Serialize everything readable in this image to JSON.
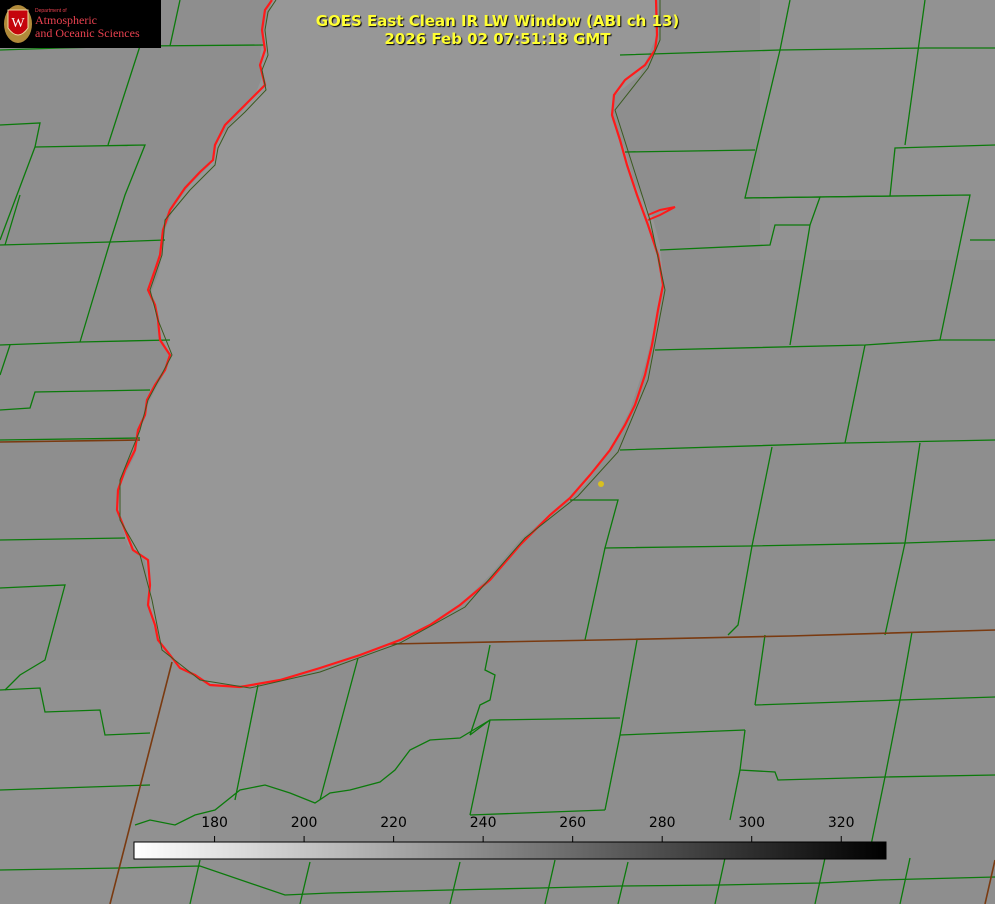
{
  "header": {
    "title": "GOES East Clean IR LW Window (ABI ch 13)",
    "timestamp": "2026 Feb 02 07:51:18 GMT"
  },
  "logo": {
    "department": "Department of",
    "line1": "Atmospheric",
    "line2": "and Oceanic Sciences",
    "seal_letter": "W"
  },
  "colorbar": {
    "tick_labels": [
      "180",
      "200",
      "220",
      "240",
      "260",
      "280",
      "300",
      "320"
    ],
    "tick_values": [
      180,
      200,
      220,
      240,
      260,
      280,
      300,
      320
    ],
    "range": [
      162,
      330
    ],
    "gradient": [
      "#ffffff",
      "#000000"
    ]
  },
  "colors": {
    "background": "#8f8f8f",
    "lake": "#969696",
    "county_lines": "#0b7a0b",
    "coastline": "#ff1a1a",
    "title_text": "#ffff33",
    "marker": "#d8c020"
  },
  "map": {
    "marker": "station-dot"
  }
}
